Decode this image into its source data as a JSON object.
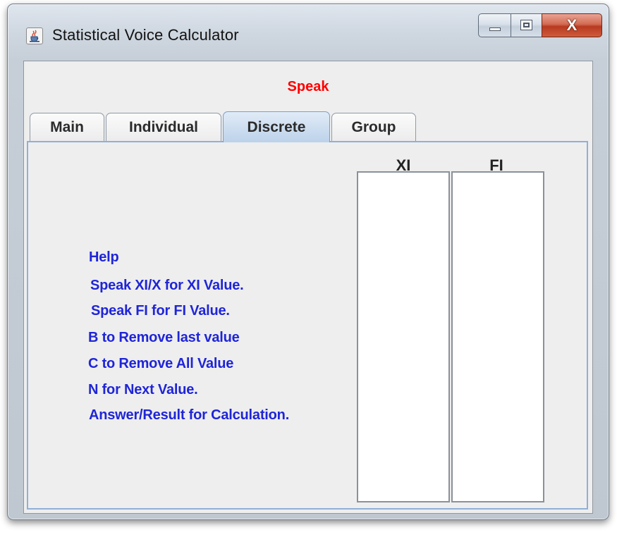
{
  "window": {
    "title": "Statistical Voice Calculator",
    "icon": "java-cup-icon",
    "controls": {
      "minimize_icon": "minimize-icon",
      "maximize_icon": "maximize-icon",
      "close_label": "X"
    }
  },
  "header": {
    "speak_label": "Speak",
    "speak_color": "#ff0000"
  },
  "tabs": [
    {
      "label": "Main",
      "selected": false
    },
    {
      "label": "Individual",
      "selected": false
    },
    {
      "label": "Discrete",
      "selected": true
    },
    {
      "label": "Group",
      "selected": false
    }
  ],
  "discrete": {
    "columns": {
      "xi": "XI",
      "fi": "FI"
    },
    "xi_values": [],
    "fi_values": [],
    "help": {
      "color": "#1f25d8",
      "lines": [
        "Help",
        "Speak XI/X for XI Value.",
        "Speak FI for FI Value.",
        "B to Remove last value",
        "C to Remove All Value",
        "N for Next Value.",
        "Answer/Result for Calculation."
      ]
    }
  }
}
